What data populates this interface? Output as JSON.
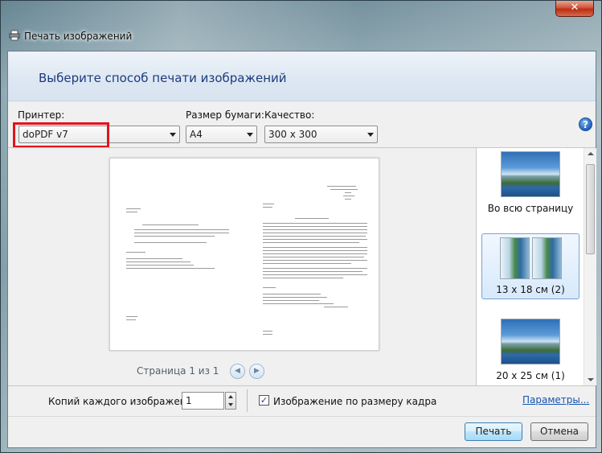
{
  "window": {
    "title": "Печать изображений",
    "close_label": "✕"
  },
  "header": {
    "instruction": "Выберите способ печати изображений"
  },
  "printer": {
    "label": "Принтер:",
    "value": "doPDF v7"
  },
  "paper": {
    "label": "Размер бумаги:",
    "value": "A4"
  },
  "quality": {
    "label": "Качество:",
    "value": "300 x 300"
  },
  "help": {
    "label": "?"
  },
  "preview": {
    "page_label": "Страница 1 из 1",
    "prev_label": "◀",
    "next_label": "▶"
  },
  "layouts": [
    {
      "label": "Во всю страницу",
      "selected": false
    },
    {
      "label": "13 x 18 см (2)",
      "selected": true
    },
    {
      "label": "20 x 25 см (1)",
      "selected": false
    }
  ],
  "copies": {
    "label": "Копий каждого изображения:",
    "value": "1"
  },
  "fit": {
    "label": "Изображение по размеру кадра",
    "checked": true,
    "check_mark": "✓"
  },
  "options_link": "Параметры...",
  "buttons": {
    "print": "Печать",
    "cancel": "Отмена"
  }
}
